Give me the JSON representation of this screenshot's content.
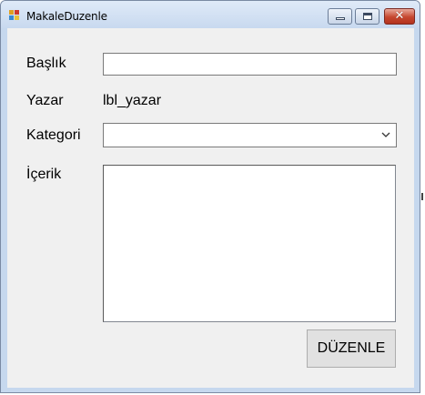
{
  "window": {
    "title": "MakaleDuzenle"
  },
  "form": {
    "baslik_label": "Başlık",
    "baslik_value": "",
    "yazar_label": "Yazar",
    "yazar_value": "lbl_yazar",
    "kategori_label": "Kategori",
    "kategori_selected": "",
    "icerik_label": "İçerik",
    "icerik_value": "",
    "submit_label": "DÜZENLE"
  },
  "icons": {
    "app": "app-icon",
    "minimize": "minimize-icon",
    "maximize": "maximize-icon",
    "close": "close-icon",
    "dropdown": "chevron-down-icon"
  },
  "colors": {
    "client_background": "#f0f0f0",
    "close_button": "#c6472f",
    "window_frame": "#c6d8ee"
  }
}
